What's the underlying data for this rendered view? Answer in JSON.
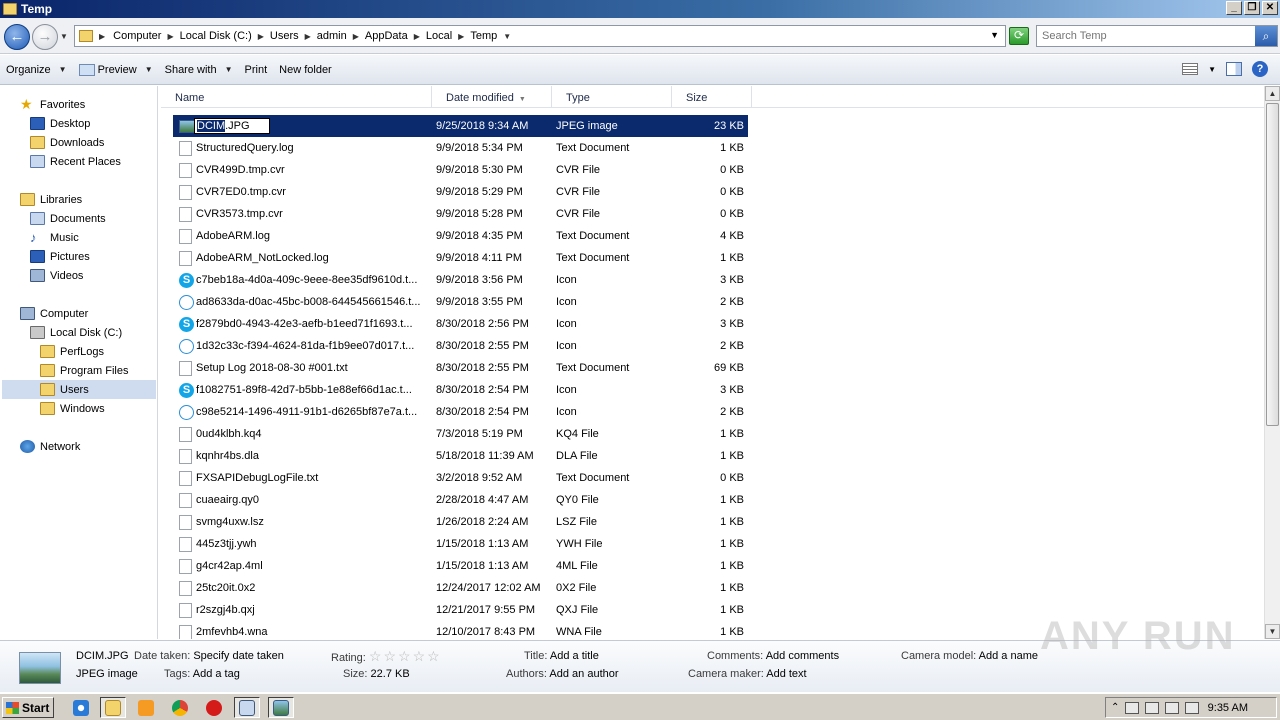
{
  "window": {
    "title": "Temp"
  },
  "address": {
    "crumbs": [
      "Computer",
      "Local Disk (C:)",
      "Users",
      "admin",
      "AppData",
      "Local",
      "Temp"
    ],
    "search_placeholder": "Search Temp"
  },
  "toolbar": {
    "organize": "Organize",
    "preview": "Preview",
    "share_with": "Share with",
    "print": "Print",
    "new_folder": "New folder"
  },
  "nav": {
    "favorites": "Favorites",
    "desktop": "Desktop",
    "downloads": "Downloads",
    "recent_places": "Recent Places",
    "libraries": "Libraries",
    "documents": "Documents",
    "music": "Music",
    "pictures": "Pictures",
    "videos": "Videos",
    "computer": "Computer",
    "local_disk": "Local Disk (C:)",
    "perflogs": "PerfLogs",
    "program_files": "Program Files",
    "users": "Users",
    "windows": "Windows",
    "network": "Network"
  },
  "columns": {
    "name": "Name",
    "date": "Date modified",
    "type": "Type",
    "size": "Size"
  },
  "rename": {
    "selected_part": "DCIM",
    "rest": ".JPG"
  },
  "files": [
    {
      "name": "DCIM.JPG",
      "date": "9/25/2018 9:34 AM",
      "type": "JPEG image",
      "size": "23 KB",
      "icon": "image-icon"
    },
    {
      "name": "StructuredQuery.log",
      "date": "9/9/2018 5:34 PM",
      "type": "Text Document",
      "size": "1 KB",
      "icon": "document-icon"
    },
    {
      "name": "CVR499D.tmp.cvr",
      "date": "9/9/2018 5:30 PM",
      "type": "CVR File",
      "size": "0 KB",
      "icon": "document-icon"
    },
    {
      "name": "CVR7ED0.tmp.cvr",
      "date": "9/9/2018 5:29 PM",
      "type": "CVR File",
      "size": "0 KB",
      "icon": "document-icon"
    },
    {
      "name": "CVR3573.tmp.cvr",
      "date": "9/9/2018 5:28 PM",
      "type": "CVR File",
      "size": "0 KB",
      "icon": "document-icon"
    },
    {
      "name": "AdobeARM.log",
      "date": "9/9/2018 4:35 PM",
      "type": "Text Document",
      "size": "4 KB",
      "icon": "document-icon"
    },
    {
      "name": "AdobeARM_NotLocked.log",
      "date": "9/9/2018 4:11 PM",
      "type": "Text Document",
      "size": "1 KB",
      "icon": "document-icon"
    },
    {
      "name": "c7beb18a-4d0a-409c-9eee-8ee35df9610d.t...",
      "date": "9/9/2018 3:56 PM",
      "type": "Icon",
      "size": "3 KB",
      "icon": "skype-icon"
    },
    {
      "name": "ad8633da-d0ac-45bc-b008-644545661546.t...",
      "date": "9/9/2018 3:55 PM",
      "type": "Icon",
      "size": "2 KB",
      "icon": "skype-outline-icon"
    },
    {
      "name": "f2879bd0-4943-42e3-aefb-b1eed71f1693.t...",
      "date": "8/30/2018 2:56 PM",
      "type": "Icon",
      "size": "3 KB",
      "icon": "skype-icon"
    },
    {
      "name": "1d32c33c-f394-4624-81da-f1b9ee07d017.t...",
      "date": "8/30/2018 2:55 PM",
      "type": "Icon",
      "size": "2 KB",
      "icon": "skype-outline-icon"
    },
    {
      "name": "Setup Log 2018-08-30 #001.txt",
      "date": "8/30/2018 2:55 PM",
      "type": "Text Document",
      "size": "69 KB",
      "icon": "document-icon"
    },
    {
      "name": "f1082751-89f8-42d7-b5bb-1e88ef66d1ac.t...",
      "date": "8/30/2018 2:54 PM",
      "type": "Icon",
      "size": "3 KB",
      "icon": "skype-icon"
    },
    {
      "name": "c98e5214-1496-4911-91b1-d6265bf87e7a.t...",
      "date": "8/30/2018 2:54 PM",
      "type": "Icon",
      "size": "2 KB",
      "icon": "skype-outline-icon"
    },
    {
      "name": "0ud4klbh.kq4",
      "date": "7/3/2018 5:19 PM",
      "type": "KQ4 File",
      "size": "1 KB",
      "icon": "document-icon"
    },
    {
      "name": "kqnhr4bs.dla",
      "date": "5/18/2018 11:39 AM",
      "type": "DLA File",
      "size": "1 KB",
      "icon": "document-icon"
    },
    {
      "name": "FXSAPIDebugLogFile.txt",
      "date": "3/2/2018 9:52 AM",
      "type": "Text Document",
      "size": "0 KB",
      "icon": "document-icon"
    },
    {
      "name": "cuaeairg.qy0",
      "date": "2/28/2018 4:47 AM",
      "type": "QY0 File",
      "size": "1 KB",
      "icon": "document-icon"
    },
    {
      "name": "svmg4uxw.lsz",
      "date": "1/26/2018 2:24 AM",
      "type": "LSZ File",
      "size": "1 KB",
      "icon": "document-icon"
    },
    {
      "name": "445z3tjj.ywh",
      "date": "1/15/2018 1:13 AM",
      "type": "YWH File",
      "size": "1 KB",
      "icon": "document-icon"
    },
    {
      "name": "g4cr42ap.4ml",
      "date": "1/15/2018 1:13 AM",
      "type": "4ML File",
      "size": "1 KB",
      "icon": "document-icon"
    },
    {
      "name": "25tc20it.0x2",
      "date": "12/24/2017 12:02 AM",
      "type": "0X2 File",
      "size": "1 KB",
      "icon": "document-icon"
    },
    {
      "name": "r2szgj4b.qxj",
      "date": "12/21/2017 9:55 PM",
      "type": "QXJ File",
      "size": "1 KB",
      "icon": "document-icon"
    },
    {
      "name": "2mfevhb4.wna",
      "date": "12/10/2017 8:43 PM",
      "type": "WNA File",
      "size": "1 KB",
      "icon": "document-icon"
    }
  ],
  "details": {
    "filename": "DCIM.JPG",
    "filetype": "JPEG image",
    "date_taken_label": "Date taken:",
    "date_taken_value": "Specify date taken",
    "tags_label": "Tags:",
    "tags_value": "Add a tag",
    "rating_label": "Rating:",
    "size_label": "Size:",
    "size_value": "22.7 KB",
    "title_label": "Title:",
    "title_value": "Add a title",
    "authors_label": "Authors:",
    "authors_value": "Add an author",
    "comments_label": "Comments:",
    "comments_value": "Add comments",
    "camera_maker_label": "Camera maker:",
    "camera_maker_value": "Add text",
    "camera_model_label": "Camera model:",
    "camera_model_value": "Add a name"
  },
  "watermark": "ANY RUN",
  "taskbar": {
    "start": "Start",
    "clock": "9:35 AM"
  }
}
